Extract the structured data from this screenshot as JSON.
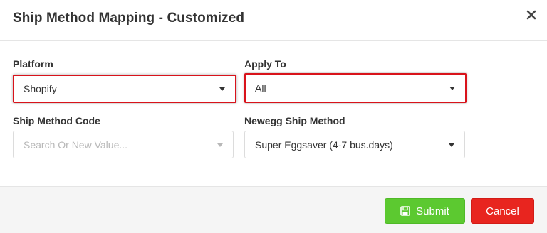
{
  "dialog": {
    "title": "Ship Method Mapping - Customized",
    "close_icon": "close-icon"
  },
  "form": {
    "platform": {
      "label": "Platform",
      "value": "Shopify"
    },
    "apply_to": {
      "label": "Apply To",
      "value": "All"
    },
    "ship_method_code": {
      "label": "Ship Method Code",
      "placeholder": "Search Or New Value..."
    },
    "newegg_ship_method": {
      "label": "Newegg Ship Method",
      "value": "Super Eggsaver (4-7 bus.days)"
    }
  },
  "footer": {
    "submit_label": "Submit",
    "submit_icon": "save-icon",
    "cancel_label": "Cancel"
  },
  "colors": {
    "highlight_border": "#d9131b",
    "submit_bg": "#5cc930",
    "cancel_bg": "#e8251f"
  }
}
